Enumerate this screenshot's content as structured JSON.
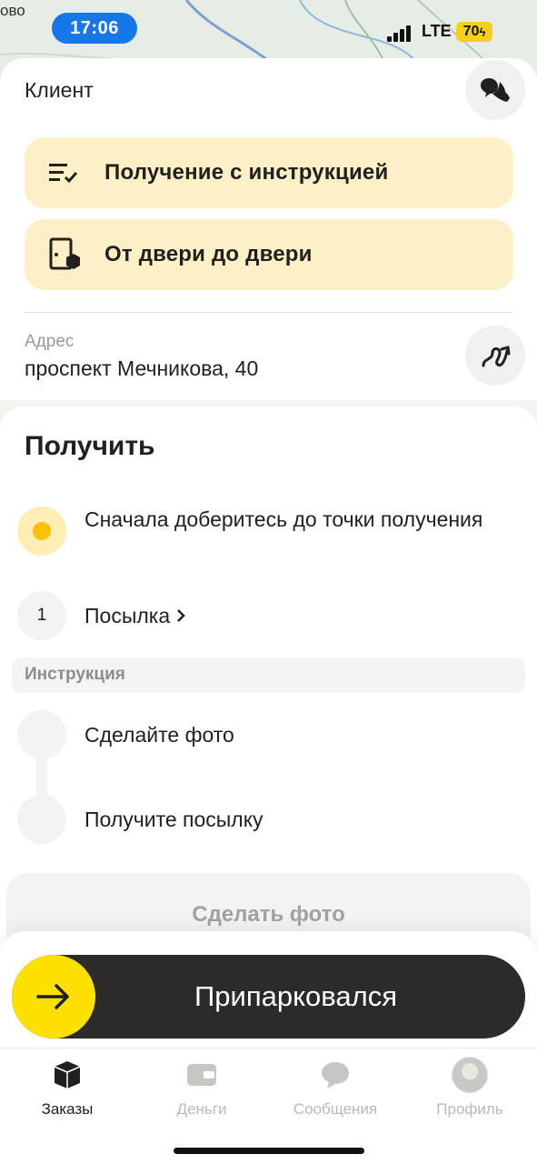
{
  "status_bar": {
    "time": "17:06",
    "network": "LTE",
    "battery": "70"
  },
  "map": {
    "label": "ово"
  },
  "client": {
    "label": "Клиент",
    "call_icon": "phone-chat-icon",
    "options": [
      {
        "label": "Получение с инструкцией",
        "icon": "checklist-icon"
      },
      {
        "label": "От двери до двери",
        "icon": "door-package-icon"
      }
    ],
    "address_caption": "Адрес",
    "address_value": "проспект Мечникова, 40",
    "route_icon": "route-icon"
  },
  "main": {
    "title": "Получить",
    "steps": [
      {
        "text": "Сначала доберитесь до точки получения",
        "state": "active"
      },
      {
        "number": "1",
        "text": "Посылка"
      }
    ],
    "instruction_header": "Инструкция",
    "instruction_steps": [
      {
        "text": "Сделайте фото"
      },
      {
        "text": "Получите посылку"
      }
    ],
    "photo_button": "Сделать фото"
  },
  "action": {
    "slider_label": "Припарковался",
    "knob_icon": "arrow-right-icon"
  },
  "tabbar": {
    "tabs": [
      {
        "label": "Заказы",
        "icon": "box-icon",
        "active": true
      },
      {
        "label": "Деньги",
        "icon": "wallet-icon",
        "active": false
      },
      {
        "label": "Сообщения",
        "icon": "chat-bubble-icon",
        "active": false
      },
      {
        "label": "Профиль",
        "icon": "avatar",
        "active": false
      }
    ]
  },
  "colors": {
    "accent": "#fce000",
    "option_bg": "#fdf0c6",
    "slider_bg": "#2c2b2a",
    "time_pill": "#1677e8"
  }
}
